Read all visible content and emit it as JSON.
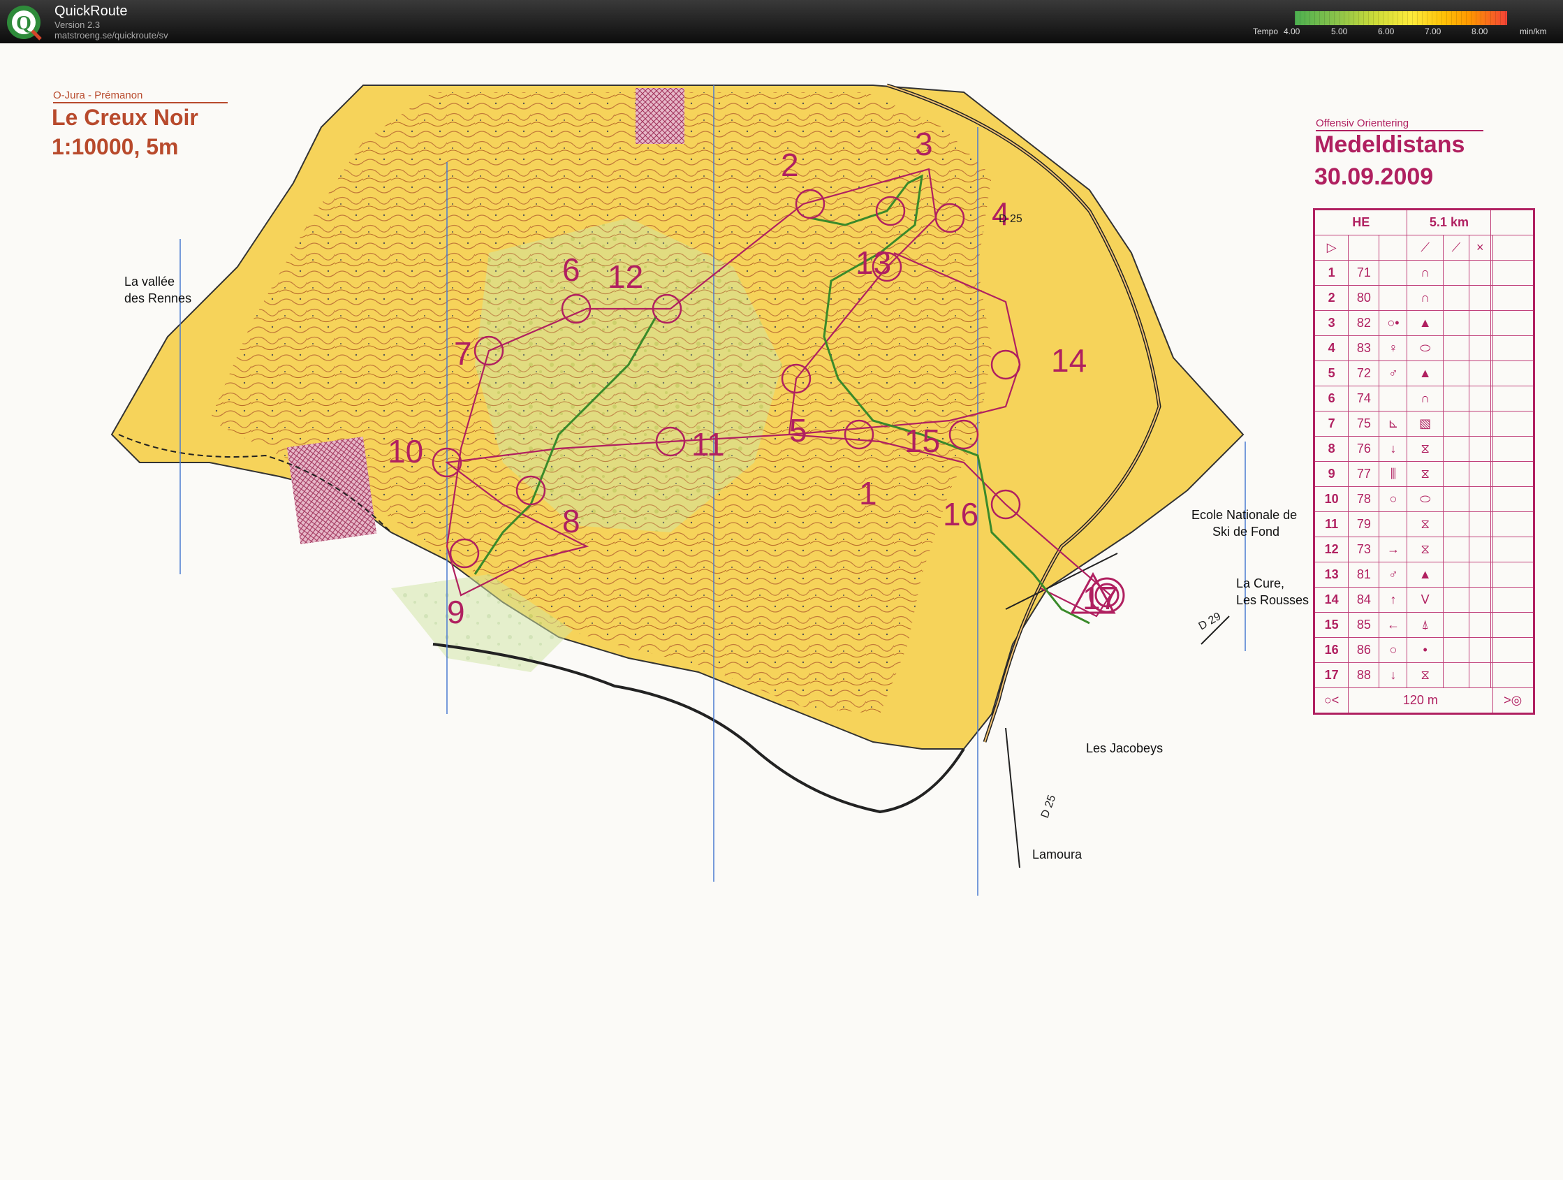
{
  "app": {
    "title": "QuickRoute",
    "version": "Version 2.3",
    "url": "matstroeng.se/quickroute/sv",
    "logo_letter": "Q"
  },
  "legend": {
    "label": "Tempo",
    "ticks": [
      "4.00",
      "5.00",
      "6.00",
      "7.00",
      "8.00"
    ],
    "unit": "min/km"
  },
  "map": {
    "club_name": "O-Jura - Prémanon",
    "map_name": "Le Creux Noir",
    "scale": "1:10000, 5m",
    "organizer": "Offensiv Orientering",
    "event": "Medeldistans",
    "date": "30.09.2009",
    "place_labels": [
      "La vallée",
      "des Rennes",
      "Ecole Nationale de",
      "Ski de Fond",
      "La Cure,",
      "Les Rousses",
      "Les Jacobeys",
      "Lamoura",
      "D 25",
      "D 29",
      "D 25"
    ],
    "controls": [
      "1",
      "2",
      "3",
      "4",
      "5",
      "6",
      "7",
      "8",
      "9",
      "10",
      "11",
      "12",
      "13",
      "14",
      "15",
      "16",
      "17"
    ],
    "course": {
      "class": "HE",
      "length": "5.1 km",
      "final_distance": "120 m",
      "rows": [
        {
          "n": "1",
          "code": "71",
          "feature": "∩",
          "extra": ""
        },
        {
          "n": "2",
          "code": "80",
          "feature": "∩",
          "extra": ""
        },
        {
          "n": "3",
          "code": "82",
          "feature": "▲",
          "extra": "○•"
        },
        {
          "n": "4",
          "code": "83",
          "feature": "⬭",
          "extra": "♀"
        },
        {
          "n": "5",
          "code": "72",
          "feature": "▲",
          "extra": "♂"
        },
        {
          "n": "6",
          "code": "74",
          "feature": "∩",
          "extra": ""
        },
        {
          "n": "7",
          "code": "75",
          "feature": "▧",
          "extra": "⊾"
        },
        {
          "n": "8",
          "code": "76",
          "feature": "⧖",
          "extra": "↓"
        },
        {
          "n": "9",
          "code": "77",
          "feature": "⧖",
          "extra": "⫼"
        },
        {
          "n": "10",
          "code": "78",
          "feature": "⬭",
          "extra": "○"
        },
        {
          "n": "11",
          "code": "79",
          "feature": "⧖",
          "extra": ""
        },
        {
          "n": "12",
          "code": "73",
          "feature": "⧖",
          "extra": "→"
        },
        {
          "n": "13",
          "code": "81",
          "feature": "▲",
          "extra": "♂"
        },
        {
          "n": "14",
          "code": "84",
          "feature": "V",
          "extra": "↑"
        },
        {
          "n": "15",
          "code": "85",
          "feature": "⍋",
          "extra": "←"
        },
        {
          "n": "16",
          "code": "86",
          "feature": "•",
          "extra": "○"
        },
        {
          "n": "17",
          "code": "88",
          "feature": "⧖",
          "extra": "↓"
        }
      ]
    }
  },
  "colors": {
    "open_land": "#f5c842",
    "forest_light": "#fbf7ea",
    "green": "#b8d88a",
    "contour": "#b36a2a",
    "course": "#b02060",
    "route": "#3a8a2a"
  }
}
